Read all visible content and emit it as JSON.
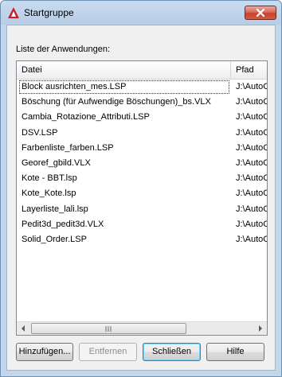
{
  "window": {
    "title": "Startgruppe",
    "close_icon": "close-icon",
    "app_icon": "autocad-icon"
  },
  "list": {
    "label": "Liste der Anwendungen:",
    "columns": [
      "Datei",
      "Pfad"
    ],
    "rows": [
      {
        "file": "Block ausrichten_mes.LSP",
        "path": "J:\\AutoC"
      },
      {
        "file": "Böschung (für Aufwendige Böschungen)_bs.VLX",
        "path": "J:\\AutoC"
      },
      {
        "file": "Cambia_Rotazione_Attributi.LSP",
        "path": "J:\\AutoC"
      },
      {
        "file": "DSV.LSP",
        "path": "J:\\AutoC"
      },
      {
        "file": "Farbenliste_farben.LSP",
        "path": "J:\\AutoC"
      },
      {
        "file": "Georef_gbild.VLX",
        "path": "J:\\AutoC"
      },
      {
        "file": "Kote - BBT.lsp",
        "path": "J:\\AutoC"
      },
      {
        "file": "Kote_Kote.lsp",
        "path": "J:\\AutoC"
      },
      {
        "file": "Layerliste_lali.lsp",
        "path": "J:\\AutoC"
      },
      {
        "file": "Pedit3d_pedit3d.VLX",
        "path": "J:\\AutoC"
      },
      {
        "file": "Solid_Order.LSP",
        "path": "J:\\AutoC"
      }
    ],
    "selected_index": 0,
    "scrollbar": {
      "grip_glyph": "|||"
    }
  },
  "buttons": {
    "add": "Hinzufügen...",
    "remove": "Entfernen",
    "close": "Schließen",
    "help": "Hilfe"
  },
  "colors": {
    "titlebar": "#b7cde6",
    "close_button": "#c4422c",
    "dialog_bg": "#f0f0f0",
    "disabled_text": "#8d8d8d",
    "default_button_border": "#3c7fb1"
  }
}
